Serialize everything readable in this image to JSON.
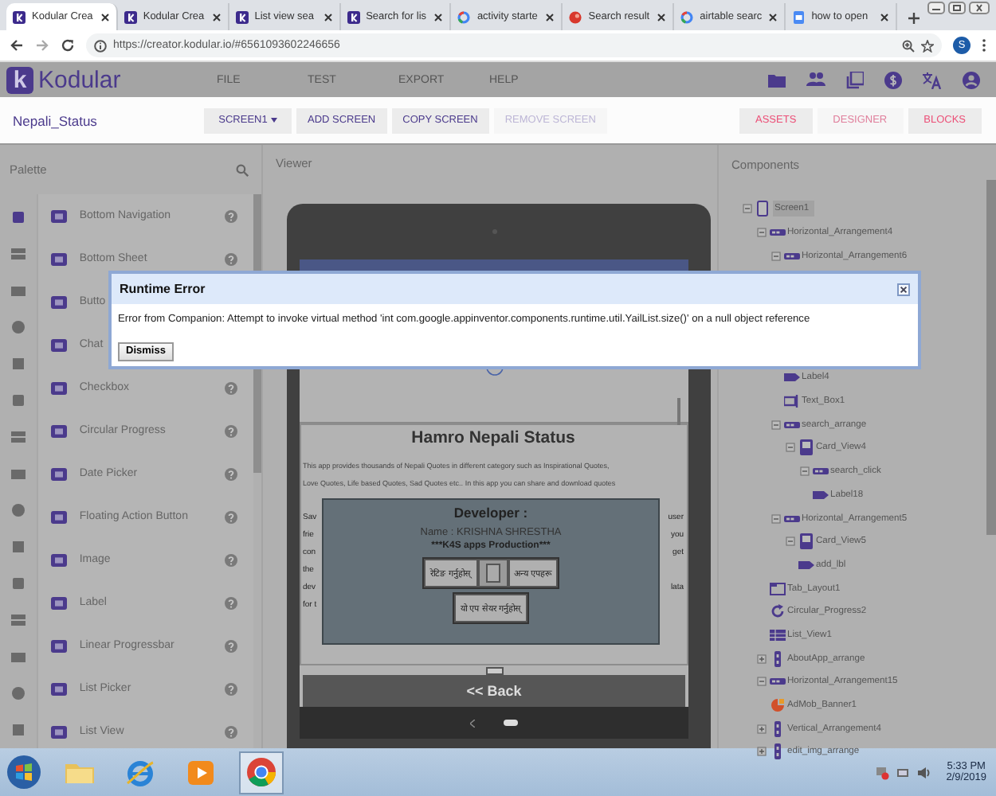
{
  "browser": {
    "tabs": [
      {
        "title": "Kodular Crea",
        "kind": "kodular",
        "selected": true
      },
      {
        "title": "Kodular Crea",
        "kind": "kodular",
        "selected": false
      },
      {
        "title": "List view sea",
        "kind": "kodular",
        "selected": false
      },
      {
        "title": "Search for lis",
        "kind": "kodular",
        "selected": false
      },
      {
        "title": "activity starte",
        "kind": "google",
        "selected": false
      },
      {
        "title": "Search result",
        "kind": "red",
        "selected": false
      },
      {
        "title": "airtable searc",
        "kind": "google",
        "selected": false
      },
      {
        "title": "how to open",
        "kind": "docs",
        "selected": false
      }
    ],
    "url": "https://creator.kodular.io/#6561093602246656",
    "profile": "S"
  },
  "app": {
    "logo_letter": "k",
    "name": "Kodular",
    "menu": [
      "FILE",
      "TEST",
      "EXPORT",
      "HELP"
    ]
  },
  "project": {
    "name": "Nepali_Status",
    "screen": "SCREEN1",
    "actions": [
      {
        "label": "ADD SCREEN",
        "disabled": false
      },
      {
        "label": "COPY SCREEN",
        "disabled": false
      },
      {
        "label": "REMOVE SCREEN",
        "disabled": true
      }
    ],
    "views": [
      {
        "label": "ASSETS",
        "disabled": false
      },
      {
        "label": "DESIGNER",
        "disabled": true
      },
      {
        "label": "BLOCKS",
        "disabled": false
      }
    ]
  },
  "palette": {
    "title": "Palette",
    "categories": [
      {
        "selected": true
      },
      {
        "selected": false
      },
      {
        "selected": false
      },
      {
        "selected": false
      },
      {
        "selected": false
      },
      {
        "selected": false
      },
      {
        "selected": false
      },
      {
        "selected": false
      },
      {
        "selected": false
      },
      {
        "selected": false
      },
      {
        "selected": false
      },
      {
        "selected": false
      },
      {
        "selected": false
      },
      {
        "selected": false
      },
      {
        "selected": false
      }
    ],
    "items": [
      {
        "label": "Bottom Navigation",
        "help": true
      },
      {
        "label": "Bottom Sheet",
        "help": true
      },
      {
        "label": "Butto",
        "help": false
      },
      {
        "label": "Chat",
        "help": false
      },
      {
        "label": "Checkbox",
        "help": true
      },
      {
        "label": "Circular Progress",
        "help": true
      },
      {
        "label": "Date Picker",
        "help": true
      },
      {
        "label": "Floating Action Button",
        "help": true
      },
      {
        "label": "Image",
        "help": true
      },
      {
        "label": "Label",
        "help": true
      },
      {
        "label": "Linear Progressbar",
        "help": true
      },
      {
        "label": "List Picker",
        "help": true
      },
      {
        "label": "List View",
        "help": true
      }
    ]
  },
  "viewer": {
    "title": "Viewer",
    "heading": "Hamro Nepali Status",
    "lines": [
      "This app provides thousands of Nepali Quotes in different category such as Inspirational Quotes,",
      "Love Quotes, Life based Quotes, Sad Quotes etc.. In this app you can share and download quotes"
    ],
    "fragments": [
      {
        "left": "Sav",
        "right": "user"
      },
      {
        "left": "frie",
        "right": "you"
      },
      {
        "left": "con",
        "right": "get"
      },
      {
        "left": "the"
      },
      {
        "left": "dev",
        "right": "lata"
      },
      {
        "left": "for t"
      }
    ],
    "developer": {
      "title": "Developer :",
      "name": "Name : KRISHNA SHRESTHA",
      "credit": "***K4S apps Production***",
      "buttons": [
        "रेटिङ गर्नुहोस्",
        "अन्य एपहरू"
      ],
      "share": "यो एप सेयर गर्नुहोस्"
    },
    "back": "<< Back"
  },
  "components": {
    "title": "Components",
    "tree": [
      {
        "label": "Screen1",
        "kind": "screen",
        "selected": true,
        "expanded": true,
        "children": [
          {
            "label": "Horizontal_Arrangement4",
            "kind": "horizontal",
            "selected": false,
            "expanded": true,
            "children": [
              {
                "label": "Horizontal_Arrangement6",
                "kind": "horizontal",
                "selected": false,
                "expanded": true,
                "children": [
                  {
                    "label": "Label4",
                    "kind": "label",
                    "selected": false
                  },
                  {
                    "label": "Text_Box1",
                    "kind": "textbox",
                    "selected": false
                  }
                ]
              },
              {
                "label": "search_arrange",
                "kind": "horizontal",
                "selected": false,
                "expanded": true,
                "children": [
                  {
                    "label": "Card_View4",
                    "kind": "card",
                    "selected": false,
                    "expanded": true,
                    "children": [
                      {
                        "label": "search_click",
                        "kind": "horizontal",
                        "selected": false,
                        "expanded": true,
                        "children": [
                          {
                            "label": "Label18",
                            "kind": "label",
                            "selected": false
                          }
                        ]
                      }
                    ]
                  }
                ]
              },
              {
                "label": "Horizontal_Arrangement5",
                "kind": "horizontal",
                "selected": false,
                "expanded": true,
                "children": [
                  {
                    "label": "Card_View5",
                    "kind": "card",
                    "selected": false,
                    "expanded": true,
                    "children": [
                      {
                        "label": "add_lbl",
                        "kind": "label",
                        "selected": false
                      }
                    ]
                  }
                ]
              },
              {
                "label": "Tab_Layout1",
                "kind": "tab",
                "selected": false
              },
              {
                "label": "Circular_Progress2",
                "kind": "progress",
                "selected": false
              },
              {
                "label": "List_View1",
                "kind": "listview",
                "selected": false
              }
            ]
          },
          {
            "label": "AboutApp_arrange",
            "kind": "vertical",
            "selected": false,
            "expanded": false
          },
          {
            "label": "Horizontal_Arrangement15",
            "kind": "horizontal",
            "selected": false,
            "expanded": true,
            "children": [
              {
                "label": "AdMob_Banner1",
                "kind": "admob",
                "selected": false
              }
            ]
          },
          {
            "label": "Vertical_Arrangement4",
            "kind": "vertical",
            "selected": false,
            "expanded": false
          },
          {
            "label": "edit_img_arrange",
            "kind": "vertical",
            "selected": false,
            "expanded": false
          }
        ]
      }
    ]
  },
  "dialog": {
    "title": "Runtime Error",
    "message": "Error from Companion: Attempt to invoke virtual method 'int com.google.appinventor.components.runtime.util.YailList.size()' on a null object reference",
    "button": "Dismiss"
  },
  "taskbar": {
    "apps": [
      {
        "kind": "folder",
        "selected": false
      },
      {
        "kind": "ie",
        "selected": false
      },
      {
        "kind": "media",
        "selected": false
      },
      {
        "kind": "chrome",
        "selected": true
      }
    ],
    "time": "5:33 PM",
    "date": "2/9/2019"
  }
}
